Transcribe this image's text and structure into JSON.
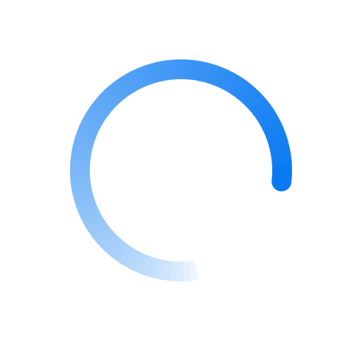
{
  "spinner": {
    "icon": "loading-spinner-icon",
    "color": "#0a7af2",
    "fade_color": "#ffffff",
    "background": "#ffffff",
    "arc_fraction": 0.8
  }
}
